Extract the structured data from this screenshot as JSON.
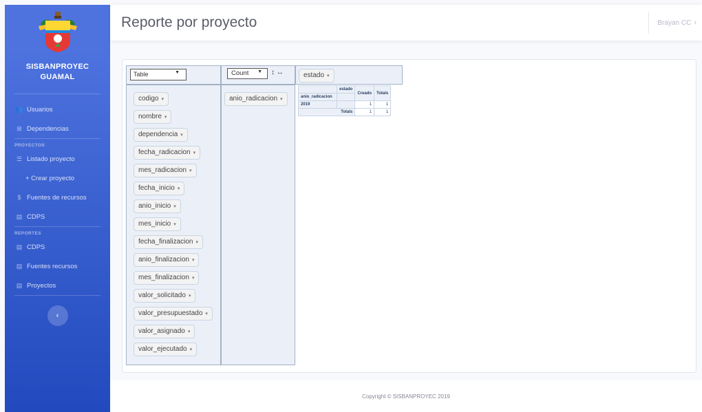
{
  "brand": {
    "line1": "SISBANPROYEC",
    "line2": "GUAMAL"
  },
  "sidebar": {
    "items": [
      {
        "label": "Usuarios",
        "icon": "users-icon"
      },
      {
        "label": "Dependencias",
        "icon": "sitemap-icon"
      }
    ],
    "section_proyectos": "PROYECTOS",
    "proyectos_items": [
      {
        "label": "Listado proyecto",
        "icon": "list-icon"
      },
      {
        "label": "+ Crear proyecto",
        "icon": "plus-icon"
      },
      {
        "label": "Fuentes de recursos",
        "icon": "dollar-icon"
      },
      {
        "label": "CDPS",
        "icon": "table-icon"
      }
    ],
    "section_reportes": "REPORTES",
    "reportes_items": [
      {
        "label": "CDPS",
        "icon": "table-icon"
      },
      {
        "label": "Fuentes recursos",
        "icon": "table-icon"
      },
      {
        "label": "Proyectos",
        "icon": "table-icon"
      }
    ],
    "toggle": "‹"
  },
  "topbar": {
    "title": "Reporte por proyecto",
    "user": "Brayan CC",
    "user_caret": "›"
  },
  "pivot": {
    "renderer": "Table",
    "aggregator": "Count",
    "sort_arrows": "↕ ↔",
    "col_attr": "estado",
    "row_attr": "anio_radicacion",
    "unused_attrs": [
      "codigo",
      "nombre",
      "dependencia",
      "fecha_radicacion",
      "mes_radicacion",
      "fecha_inicio",
      "anio_inicio",
      "mes_inicio",
      "fecha_finalizacion",
      "anio_finalizacion",
      "mes_finalizacion",
      "valor_solicitado",
      "valor_presupuestado",
      "valor_asignado",
      "valor_ejecutado"
    ],
    "table": {
      "col_label": "estado",
      "row_label": "anio_radicacion",
      "col_headers": [
        "Creado",
        "Totals"
      ],
      "rows": [
        {
          "label": "2019",
          "values": [
            "1",
            "1"
          ]
        }
      ],
      "totals_label": "Totals",
      "totals": [
        "1",
        "1"
      ]
    }
  },
  "footer": "Copyright © SISBANPROYEC 2019"
}
